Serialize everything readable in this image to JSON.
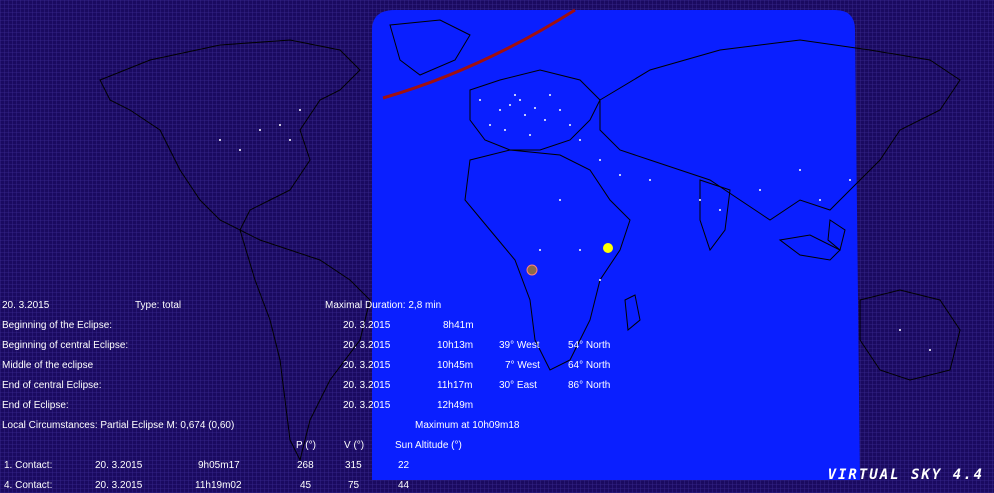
{
  "header": {
    "date": "20. 3.2015",
    "type": "Type: total",
    "max_duration": "Maximal Duration: 2,8 min"
  },
  "rows": [
    {
      "label": "Beginning of the Eclipse:",
      "date": "20. 3.2015",
      "time": "8h41m",
      "lon": "",
      "lat": ""
    },
    {
      "label": "Beginning of central Eclipse:",
      "date": "20. 3.2015",
      "time": "10h13m",
      "lon": "39° West",
      "lat": "54° North"
    },
    {
      "label": "Middle of the eclipse",
      "date": "20. 3.2015",
      "time": "10h45m",
      "lon": "7° West",
      "lat": "64° North"
    },
    {
      "label": "End of central Eclipse:",
      "date": "20. 3.2015",
      "time": "11h17m",
      "lon": "30° East",
      "lat": "86° North"
    },
    {
      "label": "End of Eclipse:",
      "date": "20. 3.2015",
      "time": "12h49m",
      "lon": "",
      "lat": ""
    }
  ],
  "local": {
    "label": "Local Circumstances: Partial Eclipse M: 0,674 (0,60)",
    "maximum": "Maximum at 10h09m18"
  },
  "contact_headers": {
    "p": "P (°)",
    "v": "V (°)",
    "alt": "Sun Altitude (°)"
  },
  "contacts": [
    {
      "label": "1. Contact:",
      "date": "20. 3.2015",
      "time": "9h05m17",
      "p": "268",
      "v": "315",
      "alt": "22"
    },
    {
      "label": "4. Contact:",
      "date": "20. 3.2015",
      "time": "11h19m02",
      "p": "45",
      "v": "75",
      "alt": "44"
    }
  ],
  "logo": "VIRTUAL SKY 4.4",
  "colors": {
    "background": "#1a0a60",
    "visibility_zone": "#0a1fff",
    "path": "#a01010",
    "sun": "#ffff00",
    "moon": "#8a6a4a"
  }
}
